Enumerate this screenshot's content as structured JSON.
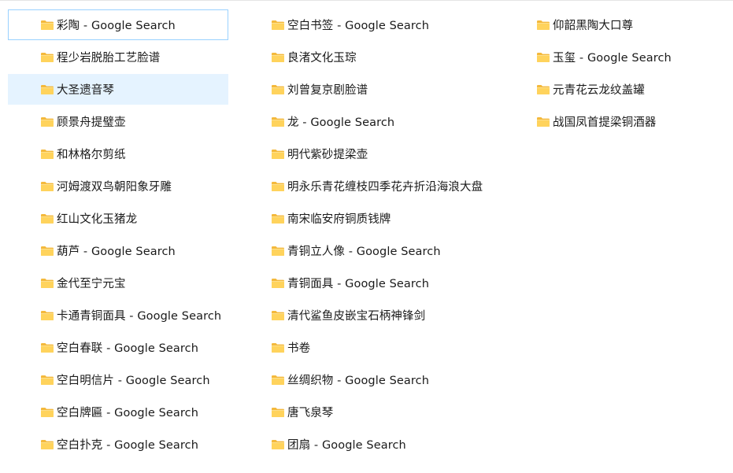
{
  "folders": {
    "column1": [
      {
        "label": "彩陶 - Google Search"
      },
      {
        "label": "程少岩脱胎工艺脸谱"
      },
      {
        "label": "大圣遗音琴"
      },
      {
        "label": "顾景舟提璧壶"
      },
      {
        "label": "和林格尔剪纸"
      },
      {
        "label": "河姆渡双鸟朝阳象牙雕"
      },
      {
        "label": "红山文化玉猪龙"
      },
      {
        "label": "葫芦 - Google Search"
      },
      {
        "label": "金代至宁元宝"
      },
      {
        "label": "卡通青铜面具 - Google Search"
      },
      {
        "label": "空白春联 - Google Search"
      },
      {
        "label": "空白明信片 - Google Search"
      },
      {
        "label": "空白牌匾 - Google Search"
      },
      {
        "label": "空白扑克 - Google Search"
      }
    ],
    "column2": [
      {
        "label": "空白书签 - Google Search"
      },
      {
        "label": "良渚文化玉琮"
      },
      {
        "label": "刘曾复京剧脸谱"
      },
      {
        "label": "龙 - Google Search"
      },
      {
        "label": "明代紫砂提梁壶"
      },
      {
        "label": "明永乐青花缠枝四季花卉折沿海浪大盘"
      },
      {
        "label": "南宋临安府铜质钱牌"
      },
      {
        "label": "青铜立人像 - Google Search"
      },
      {
        "label": "青铜面具 - Google Search"
      },
      {
        "label": "清代鲨鱼皮嵌宝石柄神锋剑"
      },
      {
        "label": "书卷"
      },
      {
        "label": "丝绸织物 - Google Search"
      },
      {
        "label": "唐飞泉琴"
      },
      {
        "label": "团扇 - Google Search"
      }
    ],
    "column3": [
      {
        "label": "仰韶黑陶大口尊"
      },
      {
        "label": "玉玺 - Google Search"
      },
      {
        "label": "元青花云龙纹盖罐"
      },
      {
        "label": "战国凤首提梁铜酒器"
      }
    ]
  },
  "icon": {
    "name": "folder-icon",
    "color_front": "#ffd35c",
    "color_back": "#f4b93c"
  },
  "state": {
    "focused": "彩陶 - Google Search",
    "hovered": "大圣遗音琴"
  }
}
